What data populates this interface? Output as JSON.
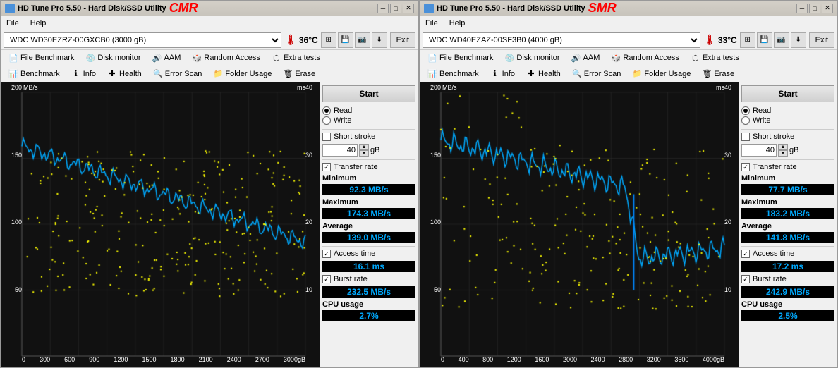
{
  "windows": [
    {
      "id": "cmr",
      "title": "HD Tune Pro 5.50 - Hard Disk/SSD Utility",
      "tag": "CMR",
      "disk": "WDC WD30EZRZ-00GXCB0 (3000 gB)",
      "temp": "36°C",
      "menu": [
        "File",
        "Help"
      ],
      "nav_row1": [
        "File Benchmark",
        "Disk monitor",
        "AAM",
        "Random Access",
        "Extra tests"
      ],
      "nav_row2": [
        "Benchmark",
        "Info",
        "Health",
        "Error Scan",
        "Folder Usage",
        "Erase"
      ],
      "start_label": "Start",
      "read_label": "Read",
      "write_label": "Write",
      "short_stroke_label": "Short stroke",
      "short_stroke_val": "40",
      "transfer_rate_label": "Transfer rate",
      "min_label": "Minimum",
      "min_val": "92.3 MB/s",
      "max_label": "Maximum",
      "max_val": "174.3 MB/s",
      "avg_label": "Average",
      "avg_val": "139.0 MB/s",
      "access_label": "Access time",
      "access_val": "16.1 ms",
      "burst_label": "Burst rate",
      "burst_val": "232.5 MB/s",
      "cpu_label": "CPU usage",
      "cpu_val": "2.7%",
      "x_labels": [
        "0",
        "300",
        "600",
        "900",
        "1200",
        "1500",
        "1800",
        "2100",
        "2400",
        "2700",
        "3000gB"
      ],
      "y_left_labels": [
        "200",
        "150",
        "100",
        "50",
        ""
      ],
      "y_right_labels": [
        "40",
        "30",
        "20",
        "10",
        ""
      ],
      "units_left": "MB/s",
      "units_right": "ms"
    },
    {
      "id": "smr",
      "title": "HD Tune Pro 5.50 - Hard Disk/SSD Utility",
      "tag": "SMR",
      "disk": "WDC WD40EZAZ-00SF3B0 (4000 gB)",
      "temp": "33°C",
      "menu": [
        "File",
        "Help"
      ],
      "nav_row1": [
        "File Benchmark",
        "Disk monitor",
        "AAM",
        "Random Access",
        "Extra tests"
      ],
      "nav_row2": [
        "Benchmark",
        "Info",
        "Health",
        "Error Scan",
        "Folder Usage",
        "Erase"
      ],
      "start_label": "Start",
      "read_label": "Read",
      "write_label": "Write",
      "short_stroke_label": "Short stroke",
      "short_stroke_val": "40",
      "transfer_rate_label": "Transfer rate",
      "min_label": "Minimum",
      "min_val": "77.7 MB/s",
      "max_label": "Maximum",
      "max_val": "183.2 MB/s",
      "avg_label": "Average",
      "avg_val": "141.8 MB/s",
      "access_label": "Access time",
      "access_val": "17.2 ms",
      "burst_label": "Burst rate",
      "burst_val": "242.9 MB/s",
      "cpu_label": "CPU usage",
      "cpu_val": "2.5%",
      "x_labels": [
        "0",
        "400",
        "800",
        "1200",
        "1600",
        "2000",
        "2400",
        "2800",
        "3200",
        "3600",
        "4000gB"
      ],
      "y_left_labels": [
        "200",
        "150",
        "100",
        "50",
        ""
      ],
      "y_right_labels": [
        "40",
        "30",
        "20",
        "10",
        ""
      ],
      "units_left": "MB/s",
      "units_right": "ms"
    }
  ]
}
